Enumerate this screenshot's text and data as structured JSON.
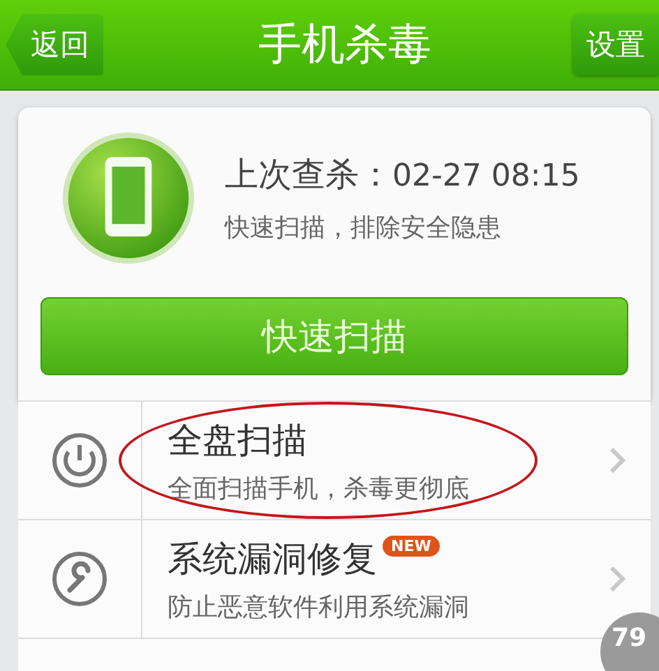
{
  "header": {
    "back": "返回",
    "title": "手机杀毒",
    "settings": "设置"
  },
  "status": {
    "label": "上次查杀：",
    "time": "02-27 08:15",
    "hint": "快速扫描，排除安全隐患"
  },
  "quick_scan_button": "快速扫描",
  "items": [
    {
      "kind": "full",
      "title": "全盘扫描",
      "subtitle": "全面扫描手机，杀毒更彻底",
      "circled": true
    },
    {
      "kind": "repair",
      "title": "系统漏洞修复",
      "subtitle": "防止恶意软件利用系统漏洞",
      "badge": "NEW",
      "circled": false
    }
  ],
  "float_widget": "79"
}
